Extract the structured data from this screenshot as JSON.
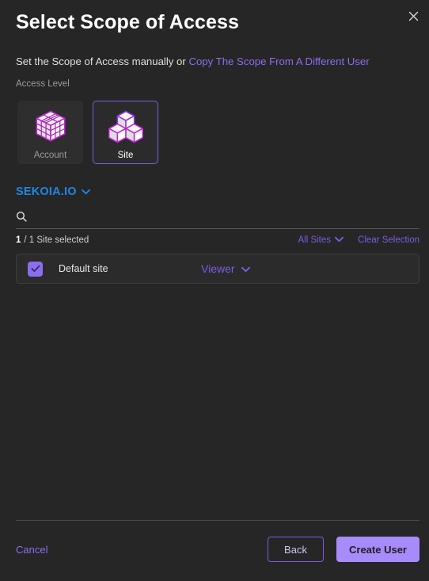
{
  "dialog": {
    "title": "Select Scope of Access",
    "close_icon": "close-icon",
    "subtitle_prefix": "Set the Scope of Access manually or ",
    "subtitle_link": "Copy The Scope From A Different User"
  },
  "access_level": {
    "label": "Access Level",
    "options": [
      {
        "label": "Account",
        "icon": "cube-grid-icon",
        "selected": false
      },
      {
        "label": "Site",
        "icon": "three-cubes-icon",
        "selected": true
      }
    ]
  },
  "organization": {
    "name": "SEKOIA.IO",
    "chevron_icon": "chevron-down-icon"
  },
  "search": {
    "icon": "search-icon",
    "value": "",
    "placeholder": ""
  },
  "selection": {
    "count": "1",
    "summary": "/ 1 Site selected",
    "filter_label": "All Sites",
    "filter_icon": "chevron-down-icon",
    "clear_label": "Clear Selection"
  },
  "sites": [
    {
      "name": "Default site",
      "checked": true,
      "check_icon": "check-icon",
      "role": "Viewer",
      "role_icon": "chevron-down-icon"
    }
  ],
  "footer": {
    "cancel_label": "Cancel",
    "back_label": "Back",
    "create_label": "Create User"
  },
  "colors": {
    "background": "#262626",
    "accent_purple": "#7c5ce0",
    "accent_purple_light": "#8b6ef0",
    "primary_button": "#a78bfa",
    "org_link_blue": "#1e88e5",
    "card_background": "#2e2e2e"
  }
}
